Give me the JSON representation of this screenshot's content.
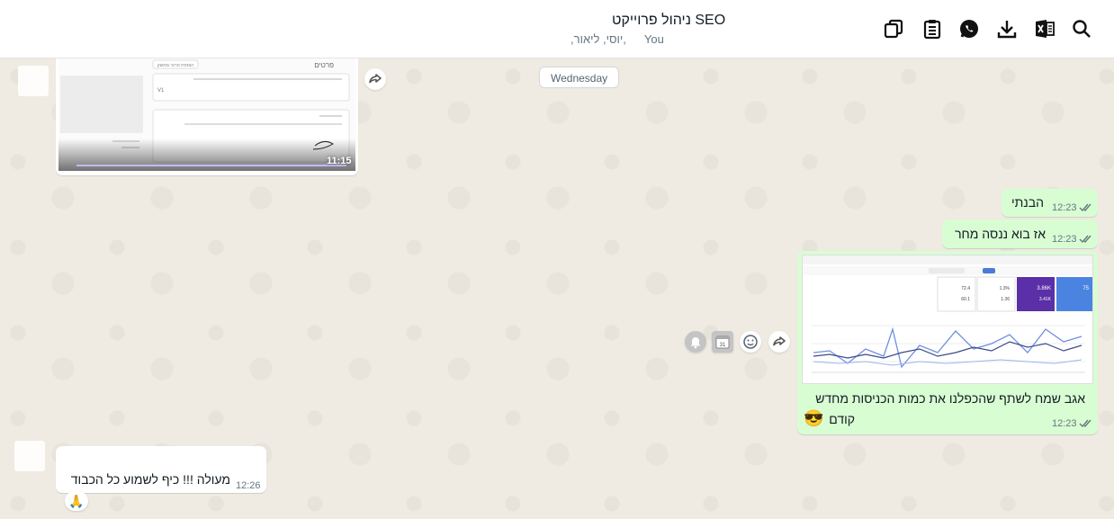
{
  "header": {
    "title": "ניהול פרוייקט SEO",
    "participants": [
      "You",
      "",
      ",יוסי, ליאור,"
    ],
    "icons": [
      "copy-icon",
      "clipboard-icon",
      "whatsapp-icon",
      "download-icon",
      "excel-icon",
      "search-icon"
    ]
  },
  "chat": {
    "date_separator": "Wednesday",
    "incoming_media": {
      "time": "11:15",
      "preview": {
        "panel_title": "פרטים",
        "button_label": "הוספת פרטי ממשק",
        "field_value": "V1"
      }
    },
    "messages_out": [
      {
        "text": "הבנתי",
        "time": "12:23"
      },
      {
        "text": "אז בוא ננסה מחר",
        "time": "12:23"
      },
      {
        "text_line1": "אגב שמח לשתף שהכפלנו את כמות הכניסות מחדש",
        "text_line2": "קודם",
        "emoji": "😎",
        "time": "12:23"
      }
    ],
    "incoming_text": {
      "text": "מעולה !!! כיף לשמוע כל הכבוד",
      "time": "12:26",
      "reaction": "🙏"
    },
    "dashboard_preview": {
      "stat_values": [
        "75",
        "3.86K",
        "3.41K",
        "1.3%",
        "72.4",
        "1.36",
        "60.1"
      ]
    }
  },
  "colors": {
    "outgoing": "#d9fdd3",
    "incoming": "#ffffff",
    "background": "#efeae2",
    "tick_blue": "#53bdeb"
  }
}
